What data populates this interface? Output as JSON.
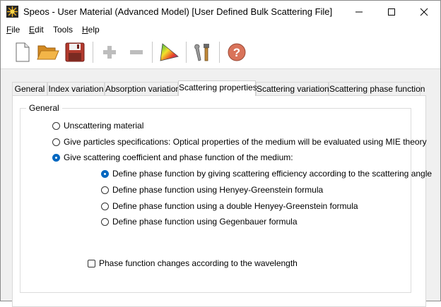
{
  "window": {
    "title": "Speos - User Material (Advanced Model) [User Defined Bulk Scattering File]",
    "icons": {
      "app": "speos-sun-icon",
      "minimize": "minimize-icon",
      "maximize": "maximize-icon",
      "close": "close-icon"
    }
  },
  "menu": {
    "file": {
      "acc": "F",
      "rest": "ile"
    },
    "edit": {
      "acc": "E",
      "rest": "dit"
    },
    "tools": {
      "acc": "",
      "rest": "Tools"
    },
    "help": {
      "acc": "H",
      "rest": "elp"
    }
  },
  "toolbar": {
    "icons": [
      "new-file-icon",
      "open-folder-icon",
      "save-floppy-icon",
      "add-plus-icon",
      "remove-minus-icon",
      "spectrum-triangle-icon",
      "tools-icon",
      "help-icon"
    ]
  },
  "tabs": [
    {
      "label": "General"
    },
    {
      "label": "Index variation"
    },
    {
      "label": "Absorption variation"
    },
    {
      "label": "Scattering properties"
    },
    {
      "label": "Scattering variation"
    },
    {
      "label": "Scattering phase function"
    }
  ],
  "active_tab": "Scattering properties",
  "general_group": {
    "title": "General",
    "options": [
      {
        "label": "Unscattering material",
        "checked": false
      },
      {
        "label": "Give particles specifications: Optical properties of the medium will be evaluated using MIE theory",
        "checked": false
      },
      {
        "label": "Give scattering coefficient and phase function of the medium:",
        "checked": true
      }
    ],
    "phase_options": [
      {
        "label": "Define phase function by giving scattering efficiency according to the scattering  angle",
        "checked": true
      },
      {
        "label": "Define phase function using Henyey-Greenstein formula",
        "checked": false
      },
      {
        "label": "Define phase function using a double Henyey-Greenstein formula",
        "checked": false
      },
      {
        "label": "Define phase function using Gegenbauer formula",
        "checked": false
      }
    ],
    "wavelength_checkbox": {
      "label": "Phase function changes according to the wavelength",
      "checked": false
    }
  }
}
